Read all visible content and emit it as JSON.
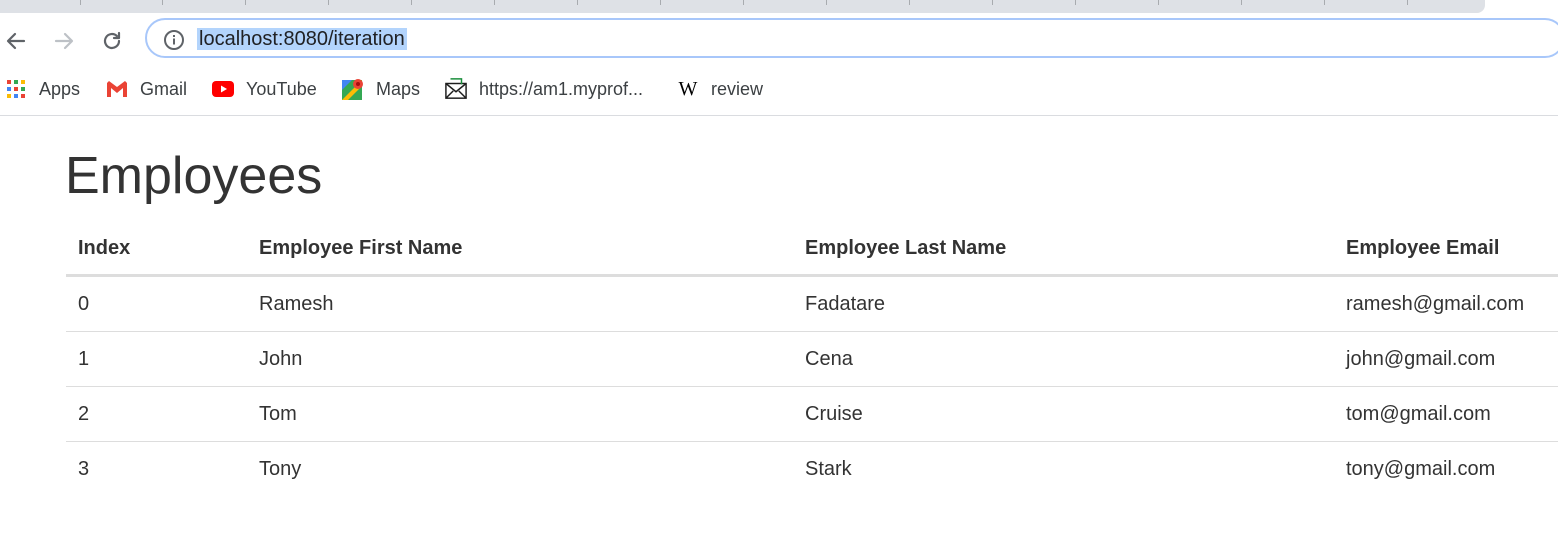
{
  "browser": {
    "url": "localhost:8080/iteration",
    "bookmarks": [
      {
        "label": "Apps",
        "icon": "apps-grid-icon"
      },
      {
        "label": "Gmail",
        "icon": "gmail-icon"
      },
      {
        "label": "YouTube",
        "icon": "youtube-icon"
      },
      {
        "label": "Maps",
        "icon": "maps-icon"
      },
      {
        "label": "https://am1.myprof...",
        "icon": "envelope-icon"
      },
      {
        "label": "review",
        "icon": "wikipedia-icon"
      }
    ]
  },
  "page": {
    "title": "Employees",
    "table": {
      "headers": [
        "Index",
        "Employee First Name",
        "Employee Last Name",
        "Employee Email"
      ],
      "rows": [
        [
          "0",
          "Ramesh",
          "Fadatare",
          "ramesh@gmail.com"
        ],
        [
          "1",
          "John",
          "Cena",
          "john@gmail.com"
        ],
        [
          "2",
          "Tom",
          "Cruise",
          "tom@gmail.com"
        ],
        [
          "3",
          "Tony",
          "Stark",
          "tony@gmail.com"
        ]
      ]
    }
  },
  "colors": {
    "url_highlight": "#b3d4fc",
    "omnibox_border": "#a8c7fa",
    "text": "#333333",
    "table_border": "#dddddd"
  }
}
